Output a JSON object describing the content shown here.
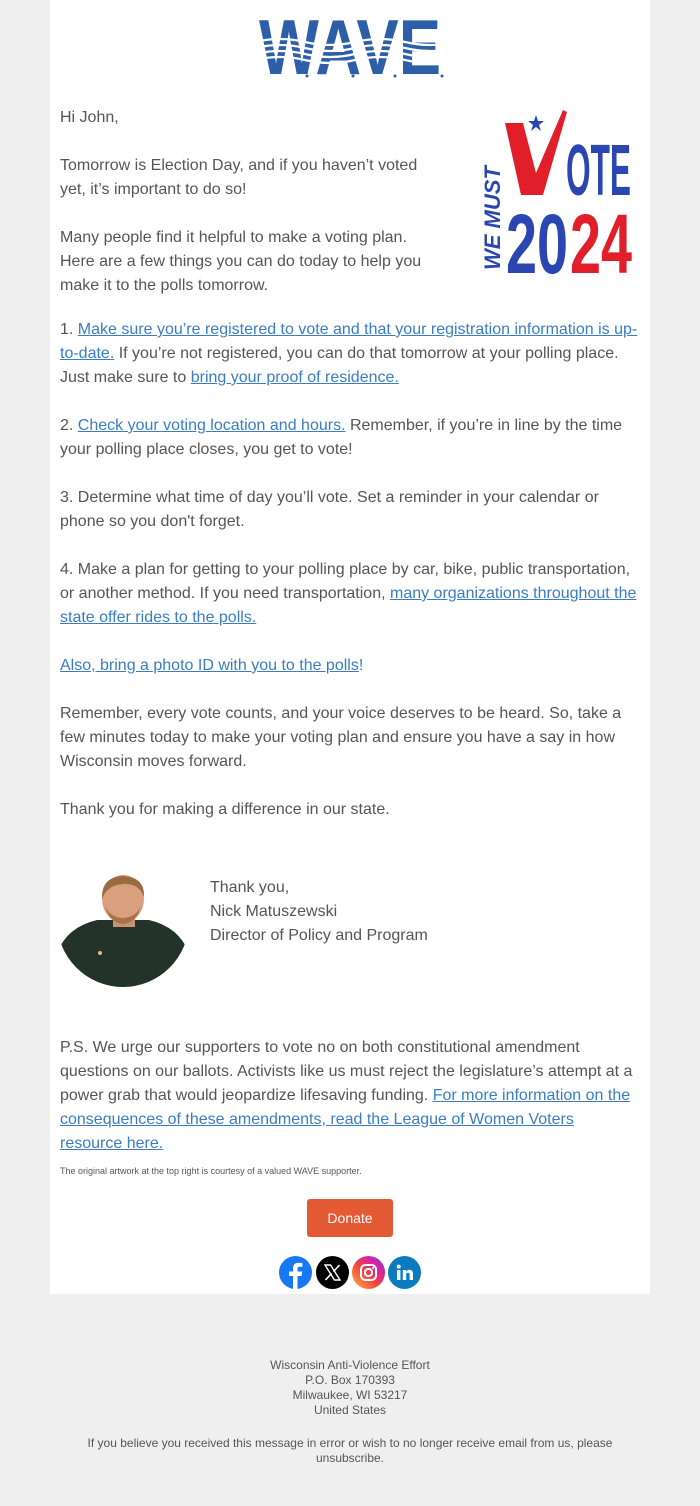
{
  "brand": {
    "logo_text": "W.A.V.E.",
    "logo_color": "#2d5ea8",
    "link_color": "#3a7dc5",
    "donate_color": "#e35a35"
  },
  "artwork": {
    "top_text": "WE MUST",
    "main_text": "VOTE",
    "year": "2024",
    "blue": "#2b46b0",
    "red": "#e01f2a"
  },
  "greeting": "Hi John,",
  "intro": [
    "Tomorrow is Election Day, and if you haven’t voted yet, it’s important to do so!",
    "Many people find it helpful to make a voting plan. Here are a few things you can do today to help you make it to the polls tomorrow."
  ],
  "steps": {
    "s1": {
      "num": "1. ",
      "link1": "Make sure you’re registered to vote and that your registration information is up-to-date.",
      "text1": " If you’re not registered, you can do that tomorrow at your polling place. Just make sure to ",
      "link2": "bring your proof of residence."
    },
    "s2": {
      "num": "2. ",
      "link1": "Check your voting location and hours.",
      "text1": " Remember, if you’re in line by the time your polling place closes, you get to vote!"
    },
    "s3": {
      "text": "3. Determine what time of day you’ll vote. Set a reminder in your calendar or phone so you don't forget."
    },
    "s4": {
      "text1": "4. Make a plan for getting to your polling place by car, bike, public transportation, or another method. If you need transportation, ",
      "link1": "many organizations throughout the state offer rides to the polls."
    }
  },
  "photo_id": {
    "link": "Also, bring a photo ID with you to the polls",
    "suffix": "!"
  },
  "closing": [
    "Remember, every vote counts, and your voice deserves to be heard. So, take a few minutes today to make your voting plan and ensure you have a say in how Wisconsin moves forward.",
    "Thank you for making a difference in our state."
  ],
  "signature": {
    "signoff": "Thank you,",
    "name": "Nick Matuszewski",
    "title": "Director of Policy and Program"
  },
  "ps": {
    "text": "P.S. We urge our supporters to vote no on both constitutional amendment questions on our ballots. Activists like us must reject the legislature’s attempt at a power grab that would jeopardize lifesaving funding. ",
    "link": "For more information on the consequences of these amendments, read the League of Women Voters resource here."
  },
  "artwork_credit": "The original artwork at the top right is courtesy of a valued WAVE supporter.",
  "donate_label": "Donate",
  "social": [
    {
      "name": "facebook",
      "glyph": "f",
      "color": "#1877f2"
    },
    {
      "name": "x",
      "glyph": "𝕏",
      "color": "#000000"
    },
    {
      "name": "instagram",
      "glyph": "◎",
      "color": "#d6249f"
    },
    {
      "name": "linkedin",
      "glyph": "in",
      "color": "#0a7bbd"
    }
  ],
  "footer": {
    "org": "Wisconsin Anti-Violence Effort",
    "po_box": "P.O. Box 170393",
    "city": "Milwaukee, WI 53217",
    "country": "United States",
    "unsubscribe": "If you believe you received this message in error or wish to no longer receive email from us, please unsubscribe."
  }
}
